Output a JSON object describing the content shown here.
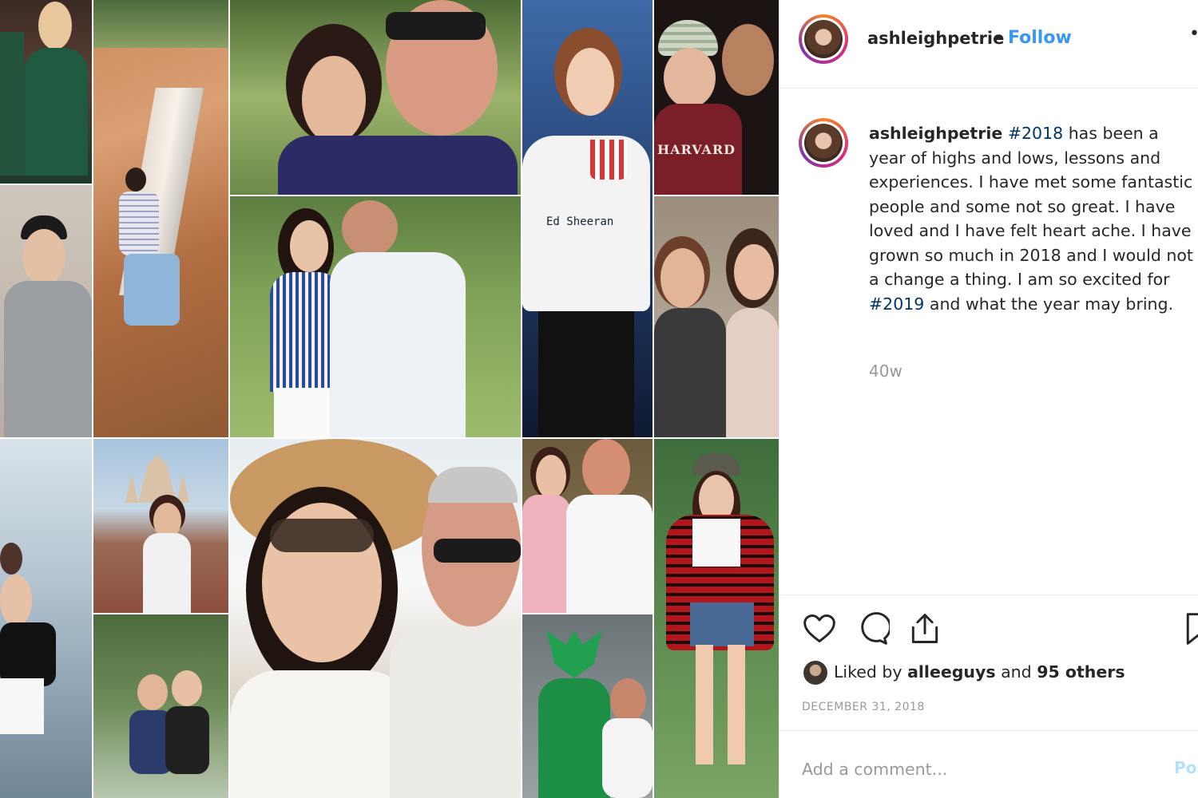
{
  "post": {
    "username": "ashleighpetrie",
    "separator": "•",
    "follow_label": "Follow",
    "more_label": "•",
    "caption": {
      "username": "ashleighpetrie",
      "tag1": "#2018",
      "text1": " has been a year of highs and lows, lessons and experiences. I have met some fantastic people and some not so great. I have loved and I have felt heart ache. I have grown so much in 2018 and I would not a change a thing. I am so excited for ",
      "tag2": "#2019",
      "text2": " and what the year may bring."
    },
    "time_ago": "40w",
    "likes": {
      "prefix": "Liked by ",
      "user": "alleeguys",
      "middle": " and ",
      "others": "95 others"
    },
    "date": "DECEMBER 31, 2018",
    "comment_placeholder": "Add a comment...",
    "post_label": "Post"
  },
  "icons": {
    "like": "heart-icon",
    "comment": "comment-icon",
    "share": "share-icon",
    "save": "bookmark-icon"
  },
  "colors": {
    "accent": "#3897f0",
    "hashtag": "#003569",
    "muted": "#999999"
  },
  "collage": {
    "printed_text": {
      "shirt": "Ed Sheeran",
      "sweater": "HARVARD"
    }
  }
}
